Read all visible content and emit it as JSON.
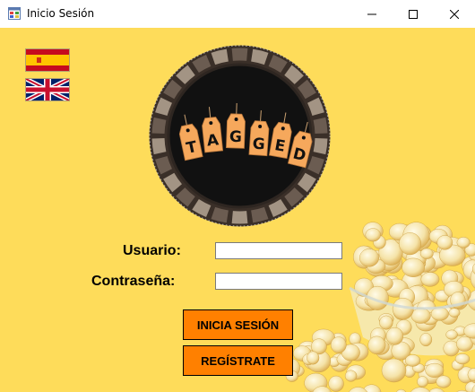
{
  "window": {
    "title": "Inicio Sesión"
  },
  "languages": [
    {
      "name": "spain-flag-icon"
    },
    {
      "name": "uk-flag-icon"
    }
  ],
  "logo": {
    "letters": [
      "T",
      "A",
      "G",
      "G",
      "E",
      "D"
    ]
  },
  "form": {
    "username_label": "Usuario:",
    "username_value": "",
    "password_label": "Contraseña:",
    "password_value": ""
  },
  "buttons": {
    "login_label": "INICIA SESIÓN",
    "register_label": "REGÍSTRATE"
  },
  "colors": {
    "background": "#fedc5a",
    "button": "#ff8000",
    "tag": "#f6a85c"
  }
}
